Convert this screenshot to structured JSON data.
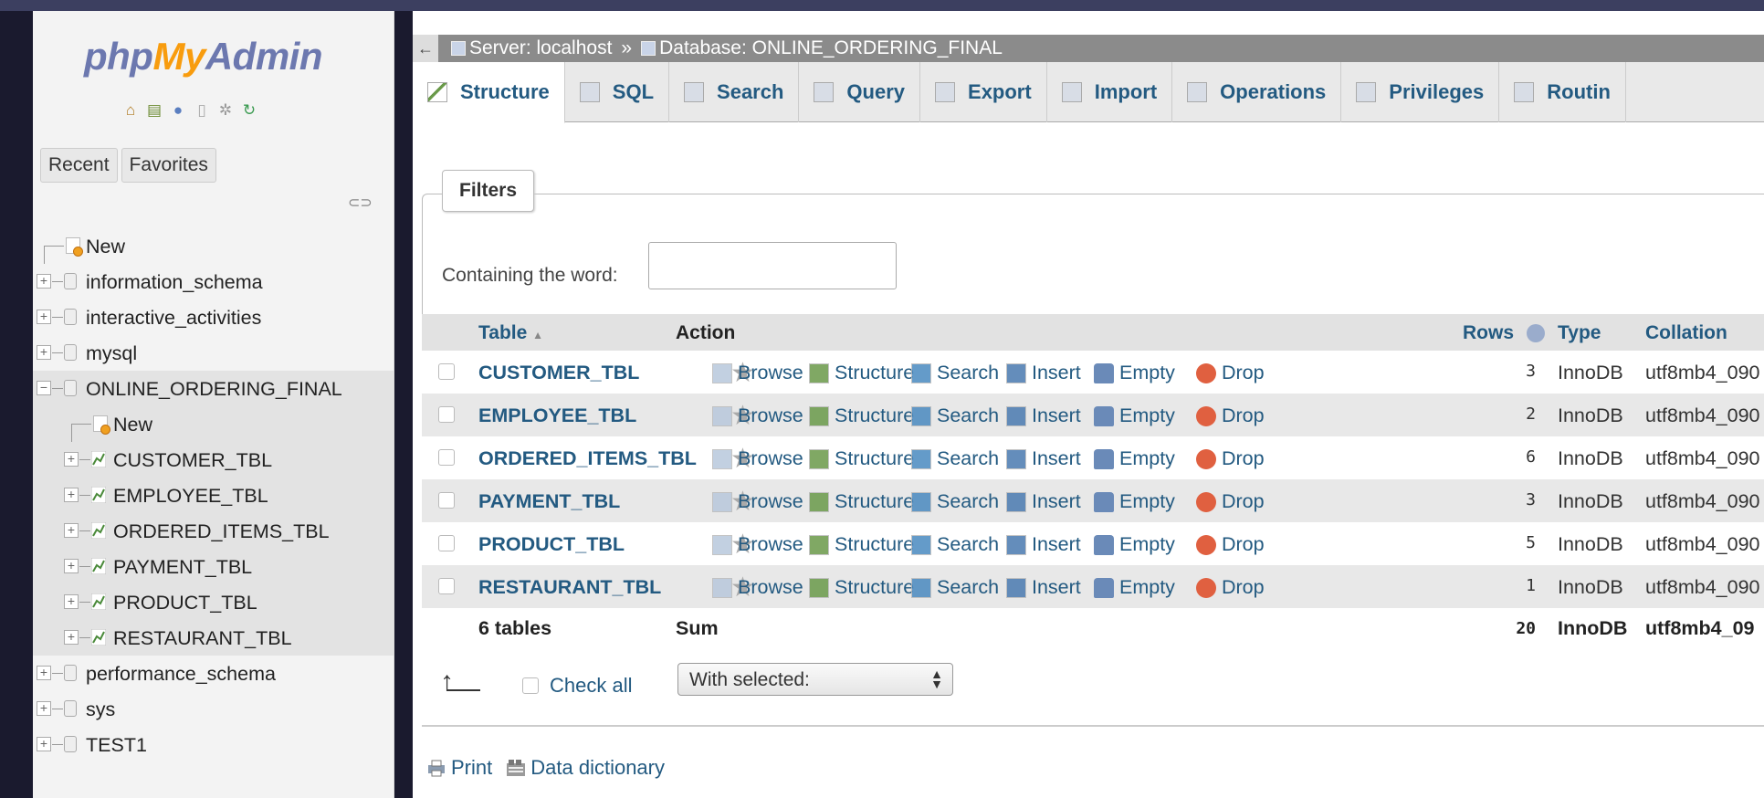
{
  "sidebar": {
    "logo": {
      "php": "php",
      "my": "My",
      "admin": "Admin"
    },
    "recent_label": "Recent",
    "favorites_label": "Favorites",
    "tree": [
      {
        "label": "New",
        "kind": "new",
        "level": 0
      },
      {
        "label": "information_schema",
        "kind": "db",
        "level": 0
      },
      {
        "label": "interactive_activities",
        "kind": "db",
        "level": 0
      },
      {
        "label": "mysql",
        "kind": "db",
        "level": 0
      },
      {
        "label": "ONLINE_ORDERING_FINAL",
        "kind": "db-open",
        "level": 0
      },
      {
        "label": "New",
        "kind": "new",
        "level": 1
      },
      {
        "label": "CUSTOMER_TBL",
        "kind": "table",
        "level": 1
      },
      {
        "label": "EMPLOYEE_TBL",
        "kind": "table",
        "level": 1
      },
      {
        "label": "ORDERED_ITEMS_TBL",
        "kind": "table",
        "level": 1
      },
      {
        "label": "PAYMENT_TBL",
        "kind": "table",
        "level": 1
      },
      {
        "label": "PRODUCT_TBL",
        "kind": "table",
        "level": 1
      },
      {
        "label": "RESTAURANT_TBL",
        "kind": "table",
        "level": 1
      },
      {
        "label": "performance_schema",
        "kind": "db",
        "level": 0
      },
      {
        "label": "sys",
        "kind": "db",
        "level": 0
      },
      {
        "label": "TEST1",
        "kind": "db",
        "level": 0
      }
    ]
  },
  "breadcrumb": {
    "back": "←",
    "server": "Server: localhost",
    "separator": "»",
    "database": "Database: ONLINE_ORDERING_FINAL"
  },
  "tabs": [
    {
      "label": "Structure",
      "icon": "structure-icon",
      "active": true
    },
    {
      "label": "SQL",
      "icon": "sql-icon"
    },
    {
      "label": "Search",
      "icon": "search-icon"
    },
    {
      "label": "Query",
      "icon": "query-icon"
    },
    {
      "label": "Export",
      "icon": "export-icon"
    },
    {
      "label": "Import",
      "icon": "import-icon"
    },
    {
      "label": "Operations",
      "icon": "wrench-icon"
    },
    {
      "label": "Privileges",
      "icon": "privileges-icon"
    },
    {
      "label": "Routin",
      "icon": "routines-icon"
    }
  ],
  "filters": {
    "legend": "Filters",
    "containing_label": "Containing the word:",
    "containing_value": ""
  },
  "table": {
    "headers": {
      "table": "Table",
      "action": "Action",
      "rows": "Rows",
      "type": "Type",
      "collation": "Collation"
    },
    "actions": [
      "Browse",
      "Structure",
      "Search",
      "Insert",
      "Empty",
      "Drop"
    ],
    "rows": [
      {
        "name": "CUSTOMER_TBL",
        "rows": "3",
        "type": "InnoDB",
        "collation": "utf8mb4_090"
      },
      {
        "name": "EMPLOYEE_TBL",
        "rows": "2",
        "type": "InnoDB",
        "collation": "utf8mb4_090"
      },
      {
        "name": "ORDERED_ITEMS_TBL",
        "rows": "6",
        "type": "InnoDB",
        "collation": "utf8mb4_090"
      },
      {
        "name": "PAYMENT_TBL",
        "rows": "3",
        "type": "InnoDB",
        "collation": "utf8mb4_090"
      },
      {
        "name": "PRODUCT_TBL",
        "rows": "5",
        "type": "InnoDB",
        "collation": "utf8mb4_090"
      },
      {
        "name": "RESTAURANT_TBL",
        "rows": "1",
        "type": "InnoDB",
        "collation": "utf8mb4_090"
      }
    ],
    "summary": {
      "count": "6 tables",
      "sum": "Sum",
      "rows": "20",
      "type": "InnoDB",
      "collation": "utf8mb4_09"
    }
  },
  "bulk": {
    "check_all": "Check all",
    "with_selected": "With selected:"
  },
  "footer": {
    "print": "Print",
    "data_dictionary": "Data dictionary"
  },
  "colors": {
    "link": "#235a81",
    "logo_blue": "#6c78af",
    "logo_orange": "#f89c0e",
    "drop_red": "#e06040"
  }
}
